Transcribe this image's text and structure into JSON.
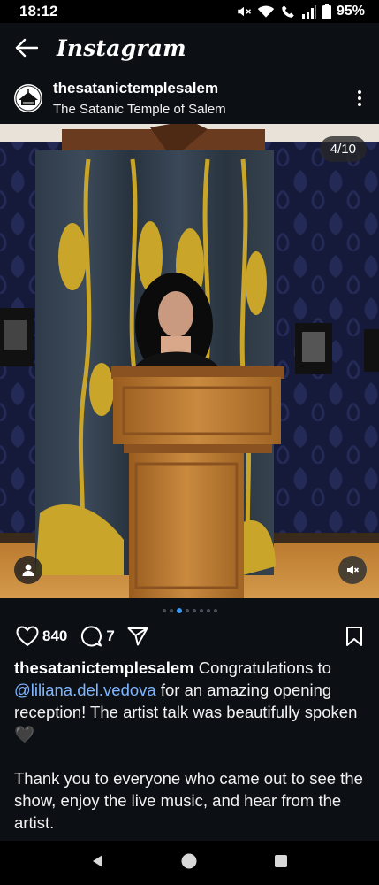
{
  "status_bar": {
    "time": "18:12",
    "battery": "95%",
    "icons": [
      "mute-icon",
      "wifi-icon",
      "wifi-calling-icon",
      "signal-icon",
      "battery-icon"
    ]
  },
  "app_bar": {
    "title": "Instagram",
    "back_icon": "back-arrow-icon"
  },
  "post": {
    "username": "thesatanictemplesalem",
    "location": "The Satanic Temple of Salem",
    "more_icon": "more-vertical-icon",
    "photo_counter": "4/10",
    "carousel_total": 8,
    "carousel_active": 2
  },
  "actions": {
    "likes": "840",
    "comments": "7",
    "icons": [
      "heart-icon",
      "comment-icon",
      "share-icon",
      "bookmark-icon"
    ]
  },
  "caption": {
    "username": "thesatanictemplesalem",
    "text_before": " Congratulations to ",
    "mention": "@liliana.del.vedova",
    "text_after": " for an amazing opening reception! The artist talk was beautifully spoken 🖤",
    "paragraph2": "Thank you to everyone who came out to see the show, enjoy the live music, and hear from the artist."
  },
  "nav_bar": {
    "icons": [
      "back-triangle-icon",
      "home-circle-icon",
      "recents-square-icon"
    ]
  },
  "colors": {
    "background": "#0c0f14",
    "link": "#7fb6ff",
    "active_dot": "#3897f0"
  }
}
